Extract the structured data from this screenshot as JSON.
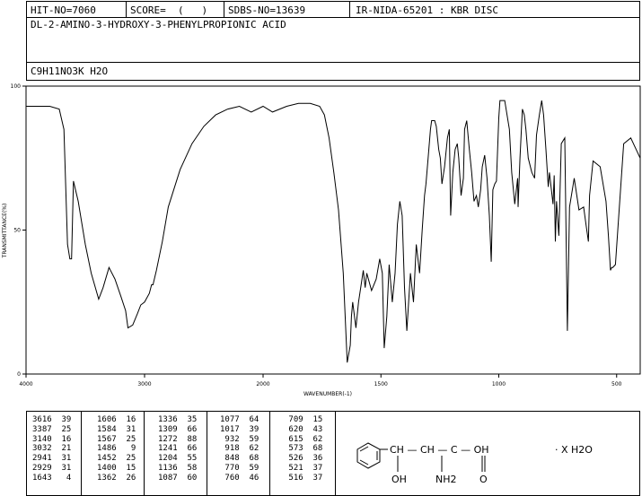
{
  "header": {
    "hit_no": "HIT-NO=7060",
    "score": "SCORE=  (   )",
    "sdbs_no": "SDBS-NO=13639",
    "ir_id": "IR-NIDA-65201 : KBR DISC",
    "compound_name": "DL-2-AMINO-3-HYDROXY-3-PHENYLPROPIONIC ACID",
    "formula": "C9H11NO3K H2O"
  },
  "chart_data": {
    "type": "line",
    "title": "",
    "xlabel": "WAVENUMBER(-1)",
    "ylabel": "TRANSMITTANCE(%)",
    "xlim": [
      4000,
      400
    ],
    "ylim": [
      0,
      100
    ],
    "x_ticks": [
      4000,
      3000,
      2000,
      1500,
      1000,
      500
    ],
    "x_tick_labels": [
      "4000",
      "3000",
      "2000",
      "1500",
      "1000",
      "500"
    ],
    "y_ticks": [
      0,
      50,
      100
    ],
    "y_tick_labels": [
      "0",
      "50",
      "100"
    ],
    "series": [
      {
        "x": [
          4000,
          3900,
          3800,
          3720,
          3680,
          3650,
          3630,
          3616,
          3600,
          3560,
          3500,
          3450,
          3387,
          3350,
          3300,
          3250,
          3200,
          3160,
          3140,
          3100,
          3060,
          3032,
          3000,
          2960,
          2941,
          2929,
          2900,
          2850,
          2800,
          2700,
          2600,
          2500,
          2400,
          2300,
          2200,
          2100,
          2000,
          1960,
          1900,
          1850,
          1800,
          1760,
          1740,
          1720,
          1700,
          1680,
          1660,
          1643,
          1630,
          1625,
          1620,
          1606,
          1595,
          1584,
          1575,
          1567,
          1560,
          1540,
          1520,
          1505,
          1494,
          1486,
          1475,
          1465,
          1452,
          1440,
          1430,
          1420,
          1410,
          1400,
          1390,
          1375,
          1362,
          1350,
          1336,
          1325,
          1315,
          1309,
          1300,
          1290,
          1285,
          1280,
          1272,
          1265,
          1255,
          1248,
          1241,
          1230,
          1218,
          1210,
          1204,
          1195,
          1185,
          1176,
          1170,
          1160,
          1150,
          1145,
          1136,
          1125,
          1115,
          1105,
          1095,
          1087,
          1077,
          1070,
          1060,
          1050,
          1040,
          1032,
          1025,
          1017,
          1010,
          1000,
          995,
          975,
          955,
          945,
          932,
          920,
          918,
          910,
          900,
          892,
          885,
          875,
          860,
          848,
          840,
          828,
          818,
          810,
          800,
          790,
          785,
          770,
          765,
          760,
          755,
          745,
          735,
          720,
          709,
          700,
          680,
          660,
          640,
          630,
          620,
          615,
          600,
          570,
          545,
          535,
          526,
          521,
          516,
          505,
          470,
          440,
          400
        ],
        "y": [
          93,
          93,
          93,
          92,
          85,
          45,
          40,
          40,
          67,
          60,
          45,
          35,
          26,
          30,
          37,
          33,
          27,
          22,
          16,
          17,
          21,
          24,
          25,
          28,
          31,
          31,
          36,
          46,
          58,
          71,
          80,
          86,
          90,
          92,
          93,
          91,
          93,
          91,
          93,
          94,
          94,
          93,
          90,
          82,
          70,
          57,
          35,
          4,
          10,
          20,
          25,
          16,
          25,
          31,
          36,
          30,
          35,
          29,
          33,
          40,
          35,
          9,
          20,
          38,
          25,
          35,
          52,
          60,
          55,
          30,
          15,
          35,
          25,
          45,
          35,
          50,
          62,
          66,
          75,
          85,
          88,
          88,
          88,
          86,
          78,
          75,
          66,
          72,
          82,
          85,
          55,
          70,
          78,
          80,
          75,
          62,
          68,
          85,
          88,
          78,
          70,
          60,
          62,
          58,
          64,
          72,
          76,
          68,
          55,
          39,
          64,
          66,
          67,
          89,
          95,
          95,
          85,
          70,
          59,
          68,
          58,
          75,
          92,
          90,
          85,
          75,
          70,
          68,
          83,
          90,
          95,
          90,
          78,
          65,
          70,
          59,
          69,
          46,
          60,
          48,
          80,
          82,
          15,
          58,
          68,
          57,
          58,
          52,
          46,
          62,
          74,
          72,
          60,
          48,
          36,
          37,
          37,
          38,
          80,
          82,
          75
        ]
      }
    ]
  },
  "peak_table": {
    "columns": [
      [
        "3616  39",
        "3387  25",
        "3140  16",
        "3032  21",
        "2941  31",
        "2929  31",
        "1643   4"
      ],
      [
        "1606  16",
        "1584  31",
        "1567  25",
        "1486   9",
        "1452  25",
        "1400  15",
        "1362  26"
      ],
      [
        "1336  35",
        "1309  66",
        "1272  88",
        "1241  66",
        "1204  55",
        "1136  58",
        "1087  60"
      ],
      [
        "1077  64",
        "1017  39",
        " 932  59",
        " 918  62",
        " 848  68",
        " 770  59",
        " 760  46"
      ],
      [
        " 709  15",
        " 620  43",
        " 615  62",
        " 573  68",
        " 526  36",
        " 521  37",
        " 516  37"
      ]
    ]
  },
  "structure": {
    "main_chain": "CH — CH — C — OH",
    "hydroxyl": "OH",
    "amine": "NH2",
    "carbonyl_o": "O",
    "hydrate": "· X H2O"
  }
}
